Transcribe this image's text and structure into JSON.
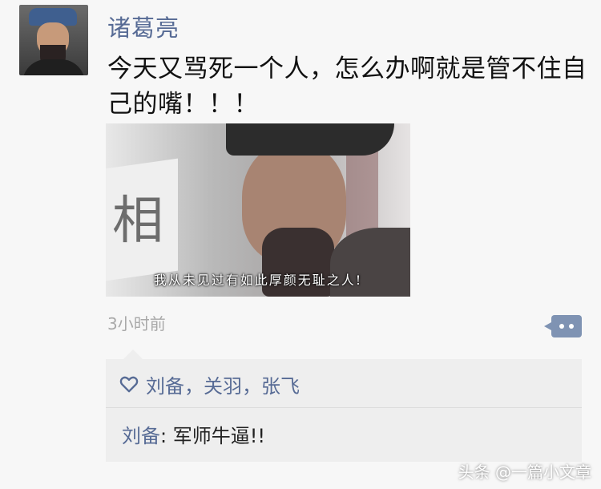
{
  "post": {
    "username": "诸葛亮",
    "text": "今天又骂死一个人，怎么办啊就是管不住自己的嘴！！！",
    "image_subtitle": "我从未见过有如此厚颜无耻之人!",
    "timestamp": "3小时前"
  },
  "interactions": {
    "likes": "刘备，关羽，张飞",
    "comment_author": "刘备",
    "comment_separator": ": ",
    "comment_text": "军师牛逼!!"
  },
  "watermark": "头条 @一篇小文章",
  "icons": {
    "like": "heart-outline-icon",
    "comment": "comment-dots-icon"
  },
  "colors": {
    "username": "#576b95",
    "comment_button": "#7f93b3",
    "interaction_bg": "#eeeeee"
  }
}
